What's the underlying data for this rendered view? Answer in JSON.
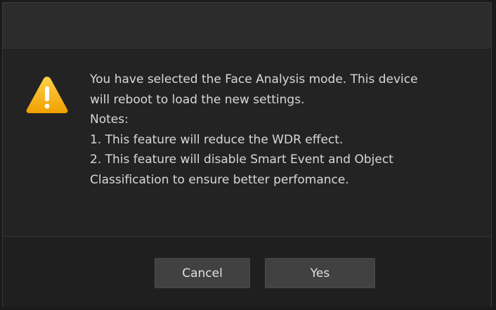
{
  "dialog": {
    "icon": "warning-triangle-icon",
    "message_lines": [
      "You have selected the Face Analysis mode. This device",
      "will reboot to load the new settings.",
      "Notes:",
      "1. This feature will reduce the WDR effect.",
      "2. This feature will disable Smart Event and Object",
      "Classification to ensure better perfomance."
    ],
    "buttons": {
      "cancel_label": "Cancel",
      "yes_label": "Yes"
    }
  },
  "colors": {
    "warning": "#f5b400",
    "background": "#262626",
    "button": "#414141"
  }
}
